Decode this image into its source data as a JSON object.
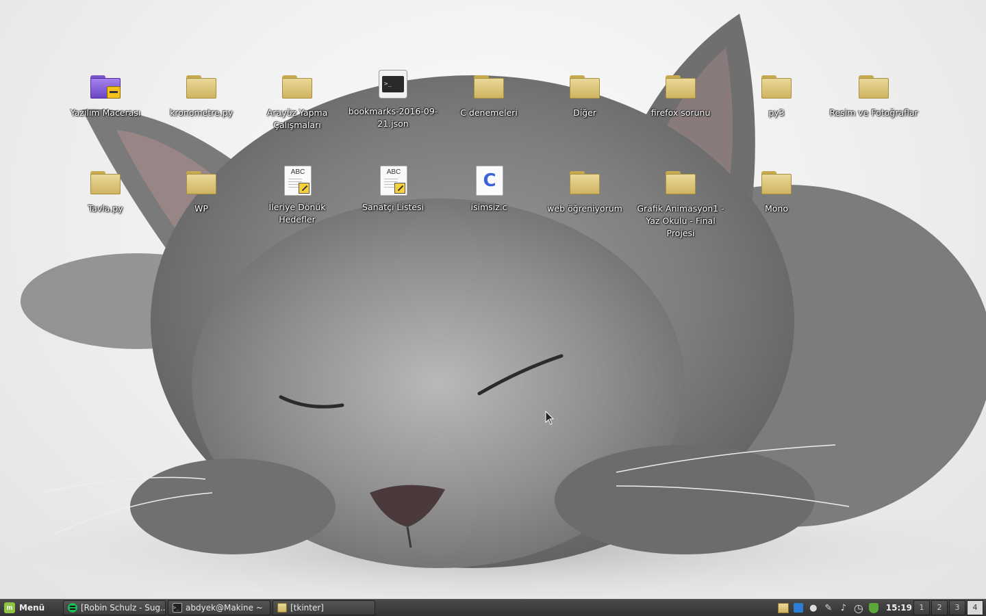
{
  "desktop": {
    "row1": [
      {
        "label": "Yazılım Macerası",
        "icon": "folder-purple-construction"
      },
      {
        "label": "kronometre.py",
        "icon": "folder"
      },
      {
        "label": "Arayüz Yapma Çalışmaları",
        "icon": "folder"
      },
      {
        "label": "bookmarks-2016-09-21.json",
        "icon": "terminal"
      },
      {
        "label": "C denemeleri",
        "icon": "folder"
      },
      {
        "label": "Diğer",
        "icon": "folder"
      },
      {
        "label": "firefox sorunu",
        "icon": "folder"
      },
      {
        "label": "py3",
        "icon": "folder"
      },
      {
        "label": "Resim ve Fotoğraflar",
        "icon": "folder"
      }
    ],
    "row2": [
      {
        "label": "Tavla.py",
        "icon": "folder"
      },
      {
        "label": "WP",
        "icon": "folder"
      },
      {
        "label": "İleriye Dönük Hedefler",
        "icon": "text-document"
      },
      {
        "label": "Sanatçı Listesi",
        "icon": "text-document"
      },
      {
        "label": "isimsiz.c",
        "icon": "c-source"
      },
      {
        "label": "web öğreniyorum",
        "icon": "folder"
      },
      {
        "label": "Grafik Animasyon1 - Yaz Okulu - Final Projesi",
        "icon": "folder"
      },
      {
        "label": "Mono",
        "icon": "folder"
      }
    ]
  },
  "taskbar": {
    "menu_label": "Menü",
    "tasks": [
      {
        "label": "[Robin Schulz - Sug...",
        "icon": "spotify-icon"
      },
      {
        "label": "abdyek@Makine ~",
        "icon": "terminal-icon"
      },
      {
        "label": "[tkinter]",
        "icon": "folder-icon"
      }
    ],
    "clock": "15:19",
    "workspaces": [
      "1",
      "2",
      "3",
      "4"
    ],
    "active_workspace": "4",
    "tray_icons": [
      "home-folder-icon",
      "network-icon",
      "user-icon",
      "pen-icon",
      "music-note-icon",
      "alarm-clock-icon",
      "update-shield-icon"
    ]
  },
  "colors": {
    "taskbar": "#3c3c3c",
    "folder": "#d8bf6e",
    "mint": "#8fc346"
  }
}
